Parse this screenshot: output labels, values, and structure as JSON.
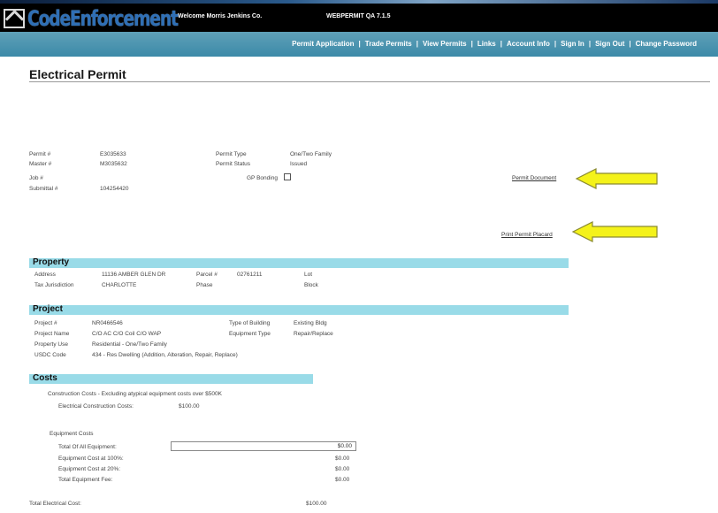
{
  "header": {
    "logo_text": "CodeEnforcement",
    "welcome": "Welcome Morris Jenkins Co.",
    "system": "WEBPERMIT QA 7.1.5"
  },
  "nav": [
    "Permit Application",
    "Trade Permits",
    "View Permits",
    "Links",
    "Account Info",
    "Sign In",
    "Sign Out",
    "Change Password"
  ],
  "page_title": "Electrical Permit",
  "permit": {
    "permit_no_label": "Permit #",
    "permit_no": "E3035633",
    "master_label": "Master #",
    "master": "M3035632",
    "job_label": "Job #",
    "submittal_label": "Submittal #",
    "submittal": "104254420",
    "type_label": "Permit Type",
    "type": "One/Two Family",
    "status_label": "Permit Status",
    "status": "Issued",
    "gp_label": "GP Bonding"
  },
  "links": {
    "document": "Permit Document",
    "placard": "Print Permit Placard"
  },
  "property": {
    "title": "Property",
    "address_label": "Address",
    "address": "11136 AMBER GLEN DR",
    "parcel_label": "Parcel #",
    "parcel": "02761211",
    "lot_label": "Lot",
    "taxj_label": "Tax Jurisdiction",
    "taxj": "CHARLOTTE",
    "phase_label": "Phase",
    "block_label": "Block"
  },
  "project": {
    "title": "Project",
    "project_no_label": "Project #",
    "project_no": "NR0466546",
    "name_label": "Project Name",
    "name": "C/O AC C/O Coil C/O WAP",
    "use_label": "Property Use",
    "use": "Residential - One/Two Family",
    "usdc_label": "USDC Code",
    "usdc": "434 - Res Dwelling (Addition, Alteration, Repair, Replace)",
    "bldg_label": "Type of Building",
    "bldg": "Existing Bldg",
    "equip_label": "Equipment Type",
    "equip": "Repair/Replace"
  },
  "costs": {
    "title": "Costs",
    "note": "Construction Costs - Excluding atypical equipment costs over $500K",
    "elec_label": "Electrical Construction Costs:",
    "elec": "$100.00",
    "equip_heading": "Equipment Costs",
    "total_equip_label": "Total Of All Equipment:",
    "total_equip": "$0.00",
    "at100_label": "Equipment Cost at 100%:",
    "at100": "$0.00",
    "at20_label": "Equipment Cost at 20%:",
    "at20": "$0.00",
    "fee_label": "Total Equipment Fee:",
    "fee": "$0.00",
    "total_elec_label": "Total Electrical Cost:",
    "total_elec": "$100.00"
  }
}
